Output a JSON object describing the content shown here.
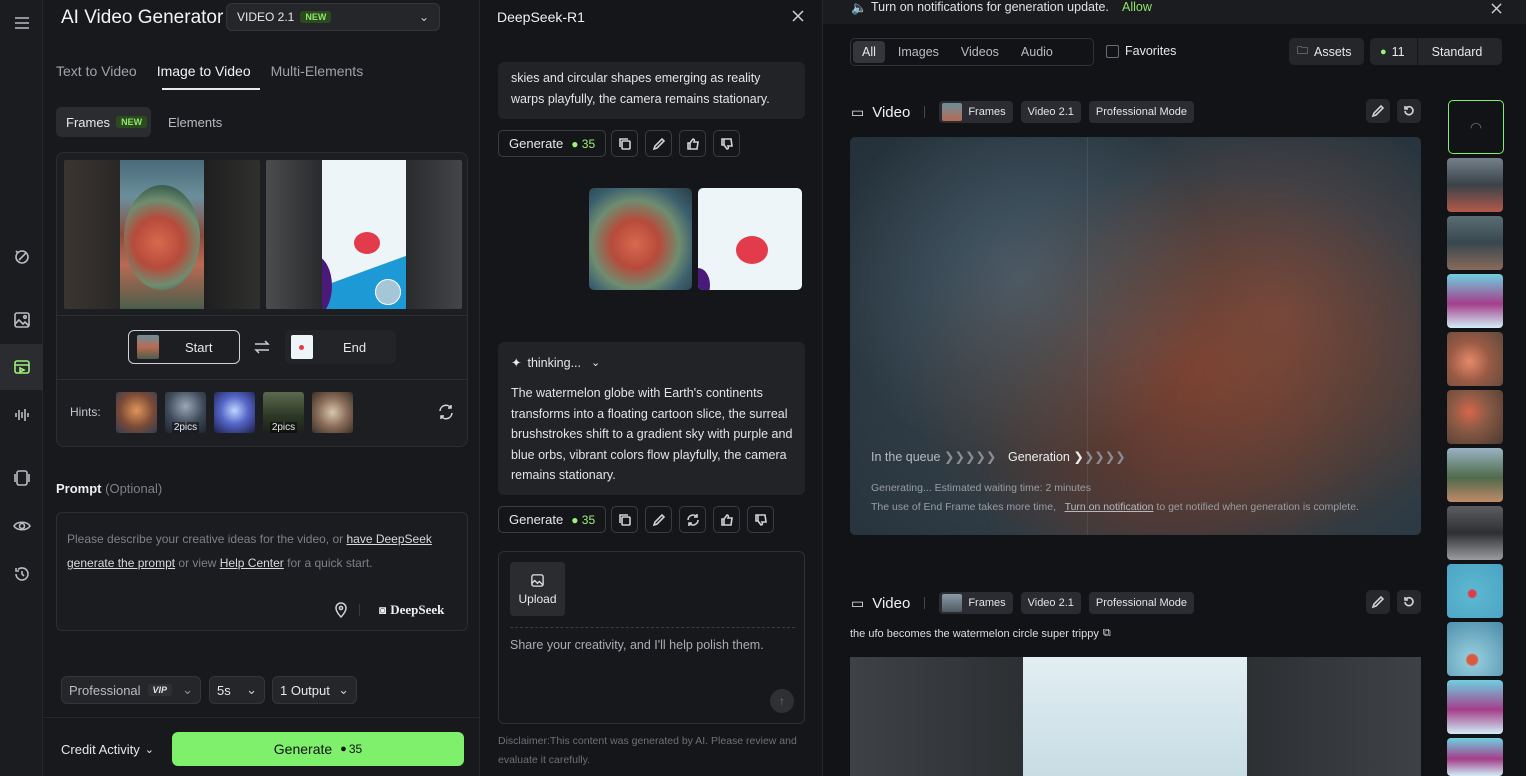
{
  "rail": {
    "icons": [
      "menu-icon",
      "magic-icon",
      "image-icon",
      "video-icon",
      "audio-icon",
      "pages-icon",
      "eye-icon",
      "history-icon"
    ]
  },
  "left": {
    "app_title": "AI Video Generator",
    "model": {
      "label": "VIDEO 2.1",
      "badge": "NEW"
    },
    "tabs": [
      "Text to Video",
      "Image to Video",
      "Multi-Elements"
    ],
    "subtabs": {
      "frames": "Frames",
      "frames_badge": "NEW",
      "elements": "Elements"
    },
    "start_label": "Start",
    "end_label": "End",
    "hints_label": "Hints:",
    "hints": [
      "",
      "2pics",
      "",
      "2pics",
      ""
    ],
    "prompt_label": "Prompt",
    "prompt_optional": "(Optional)",
    "prompt_placeholder": {
      "p1": "Please describe your creative ideas for the video, or ",
      "link1": "have DeepSeek generate the prompt",
      "p2": " or view ",
      "link2": "Help Center",
      "p3": " for a quick start."
    },
    "deepseek_label": "DeepSeek",
    "mode_select": {
      "value": "Professional",
      "badge": "VIP"
    },
    "duration_select": "5s",
    "output_select": "1 Output",
    "credit_activity": "Credit Activity",
    "generate": {
      "label": "Generate",
      "credits": "35"
    }
  },
  "mid": {
    "title": "DeepSeek-R1",
    "msg1_tail": "skies and circular shapes emerging as reality warps playfully, the camera remains stationary.",
    "generate_label": "Generate",
    "generate_credits": "35",
    "thinking_label": "thinking...",
    "msg2": "The watermelon globe with Earth's continents transforms into a floating cartoon slice, the surreal brushstrokes shift to a gradient sky with purple and blue orbs, vibrant colors flow playfully, the camera remains stationary.",
    "upload_label": "Upload",
    "input_placeholder": "Share your creativity, and I'll help polish them.",
    "disclaimer": "Disclaimer:This content was generated by AI. Please review and evaluate it carefully."
  },
  "right": {
    "notification": {
      "text": "Turn on notifications for generation update.",
      "action": "Allow"
    },
    "filters": [
      "All",
      "Images",
      "Videos",
      "Audio"
    ],
    "favorites": "Favorites",
    "assets": "Assets",
    "credits": "11",
    "plan": "Standard",
    "cards": [
      {
        "label": "Video",
        "chips": [
          "Frames",
          "Video 2.1",
          "Professional Mode"
        ],
        "queue": "In the queue",
        "generation": "Generation",
        "status1": "Generating... Estimated waiting time: 2 minutes",
        "status2a": "The use of End Frame takes more time,",
        "status2link": "Turn on notification",
        "status2b": "to get notified when generation is complete."
      },
      {
        "label": "Video",
        "chips": [
          "Frames",
          "Video 2.1",
          "Professional Mode"
        ],
        "prompt": "the ufo becomes the watermelon circle super trippy"
      }
    ]
  }
}
